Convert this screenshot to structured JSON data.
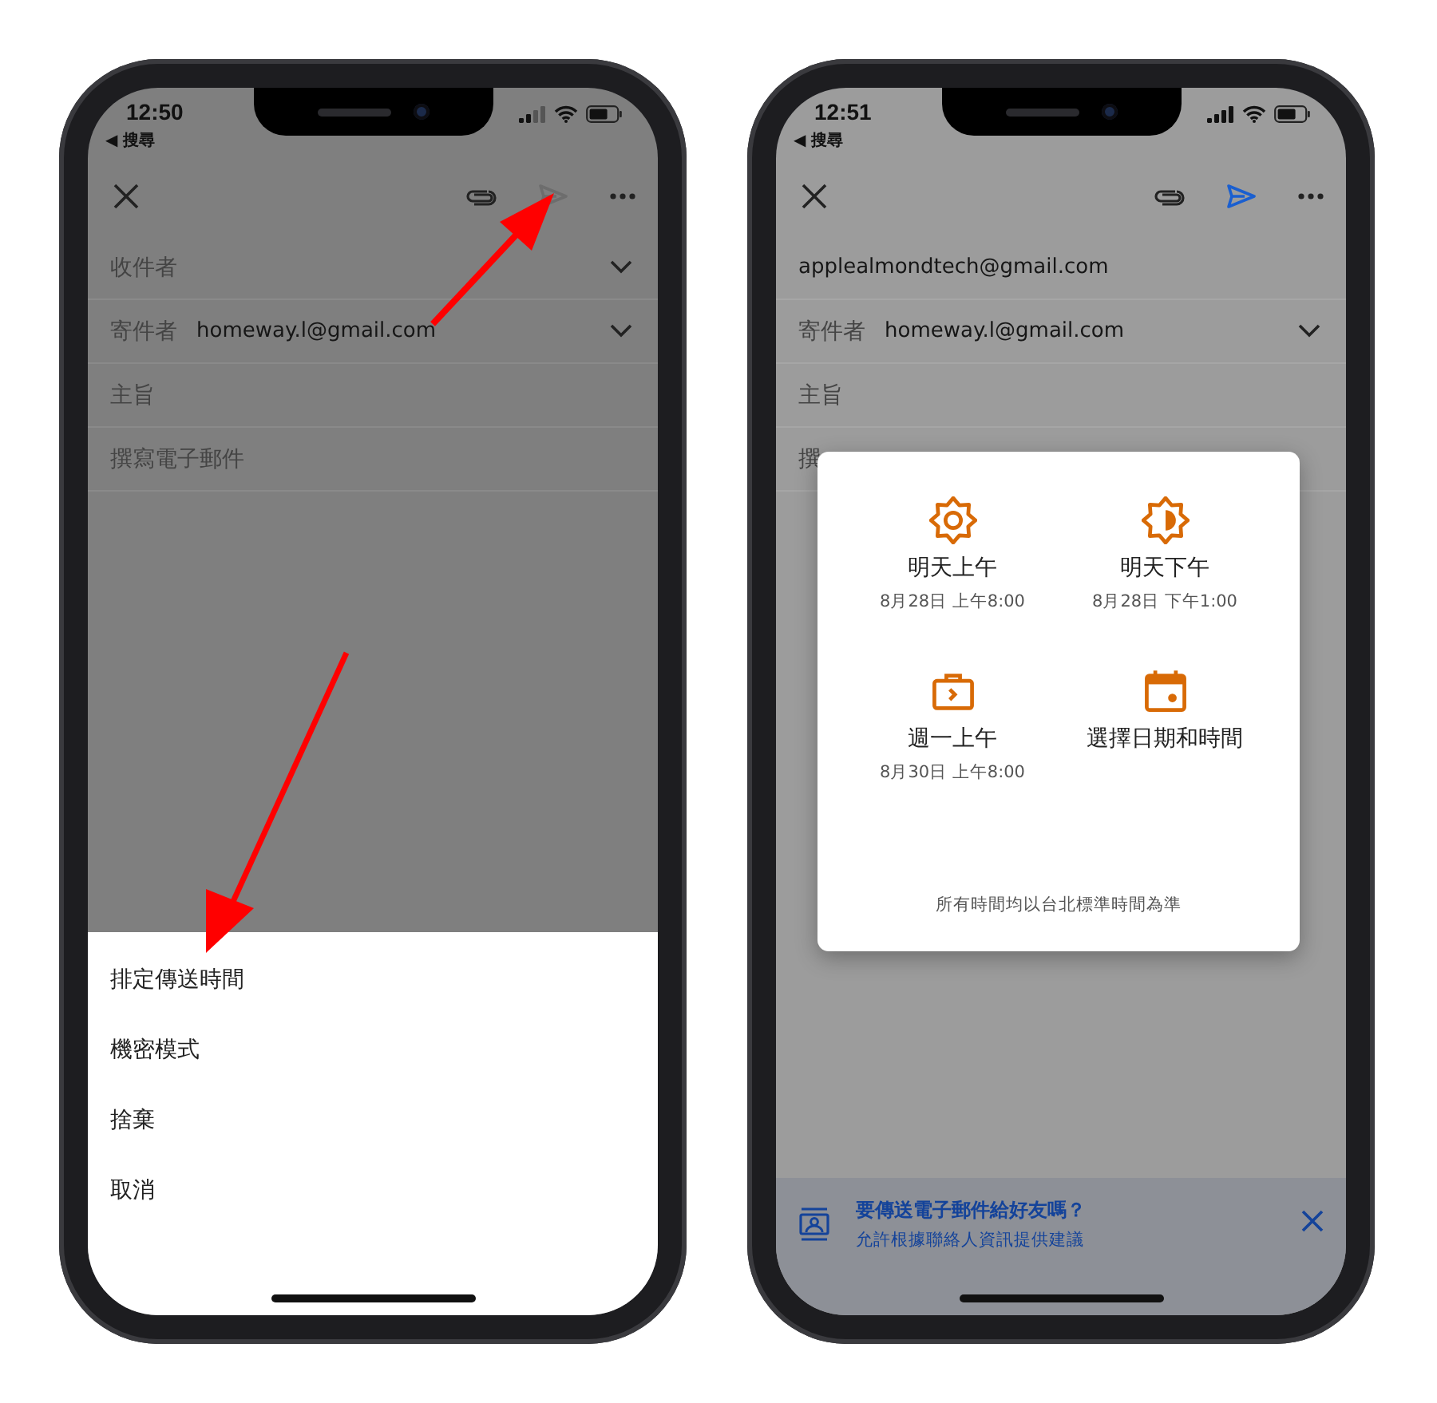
{
  "phones": [
    {
      "kind": "menu",
      "annotated": true,
      "status": {
        "time": "12:50",
        "back": "◀ 搜尋"
      },
      "toolbar": {
        "send_enabled": false
      },
      "fields": [
        {
          "label": "收件者",
          "chevron": true
        },
        {
          "label": "寄件者",
          "value": "homeway.l@gmail.com",
          "chevron": true
        },
        {
          "label": "主旨",
          "chevron": false
        },
        {
          "label": "撰寫電子郵件",
          "chevron": false
        }
      ],
      "menu": [
        "排定傳送時間",
        "機密模式",
        "捨棄",
        "取消"
      ]
    },
    {
      "kind": "schedule",
      "annotated": false,
      "status": {
        "time": "12:51",
        "back": "◀ 搜尋"
      },
      "toolbar": {
        "send_enabled": true
      },
      "fields": [
        {
          "value": "applealmondtech@gmail.com",
          "chevron": false
        },
        {
          "label": "寄件者",
          "value": "homeway.l@gmail.com",
          "chevron": true
        },
        {
          "label": "主旨",
          "chevron": false
        },
        {
          "label": "撰",
          "chevron": false
        }
      ],
      "dialog": {
        "options": [
          {
            "kind": "sun",
            "title": "明天上午",
            "time": "8月28日 上午8:00"
          },
          {
            "kind": "half-sun",
            "title": "明天下午",
            "time": "8月28日 下午1:00"
          },
          {
            "kind": "briefcase",
            "title": "週一上午",
            "time": "8月30日 上午8:00"
          },
          {
            "kind": "calendar",
            "title": "選擇日期和時間"
          }
        ],
        "note": "所有時間均以台北標準時間為準"
      },
      "banner": {
        "title": "要傳送電子郵件給好友嗎？",
        "subtitle": "允許根據聯絡人資訊提供建議"
      }
    }
  ]
}
